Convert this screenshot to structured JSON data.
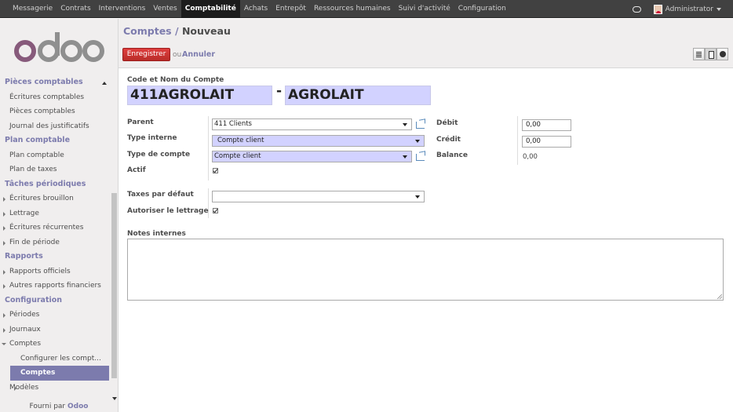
{
  "topbar": {
    "menu": [
      "Messagerie",
      "Contrats",
      "Interventions",
      "Ventes",
      "Comptabilité",
      "Achats",
      "Entrepôt",
      "Ressources humaines",
      "Suivi d'activité",
      "Configuration"
    ],
    "active": "Comptabilité",
    "user": "Administrator"
  },
  "sidebar": {
    "logo": "odoo",
    "sections": [
      {
        "title": "Pièces comptables",
        "items": [
          "Écritures comptables",
          "Pièces comptables",
          "Journal des justificatifs"
        ]
      },
      {
        "title": "Plan comptable",
        "items": [
          "Plan comptable",
          "Plan de taxes"
        ]
      },
      {
        "title": "Tâches périodiques",
        "items": [
          "Écritures brouillon",
          "Lettrage",
          "Écritures récurrentes",
          "Fin de période"
        ]
      },
      {
        "title": "Rapports",
        "items": [
          "Rapports officiels",
          "Autres rapports financiers"
        ]
      },
      {
        "title": "Configuration",
        "items": [
          "Périodes",
          "Journaux",
          "Comptes",
          "Configurer les compt...",
          "Comptes",
          "Modèles"
        ]
      }
    ],
    "powered_prefix": "Fourni par",
    "powered_brand": "Odoo"
  },
  "header": {
    "breadcrumb_parent": "Comptes",
    "separator": "/",
    "breadcrumb_current": "Nouveau",
    "save_label": "Enregistrer",
    "or_label": "ou",
    "cancel_label": "Annuler"
  },
  "form": {
    "code_name_label": "Code et Nom du Compte",
    "code": "411AGROLAIT",
    "dash": "-",
    "name": "AGROLAIT",
    "parent_label": "Parent",
    "parent_value": "411 Clients",
    "internal_type_label": "Type interne",
    "internal_type_value": "Compte client",
    "account_type_label": "Type de compte",
    "account_type_value": "Compte client",
    "active_label": "Actif",
    "active_checked": true,
    "debit_label": "Débit",
    "debit_value": "0,00",
    "credit_label": "Crédit",
    "credit_value": "0,00",
    "balance_label": "Balance",
    "balance_value": "0,00",
    "default_taxes_label": "Taxes par défaut",
    "default_taxes_value": "",
    "allow_reconcile_label": "Autoriser le lettrage",
    "allow_reconcile_checked": true,
    "notes_label": "Notes internes"
  },
  "colors": {
    "accent": "#7c7bad",
    "required_bg": "#d2d2ff",
    "save_button": "#c9302c",
    "topbar": "#414141"
  }
}
